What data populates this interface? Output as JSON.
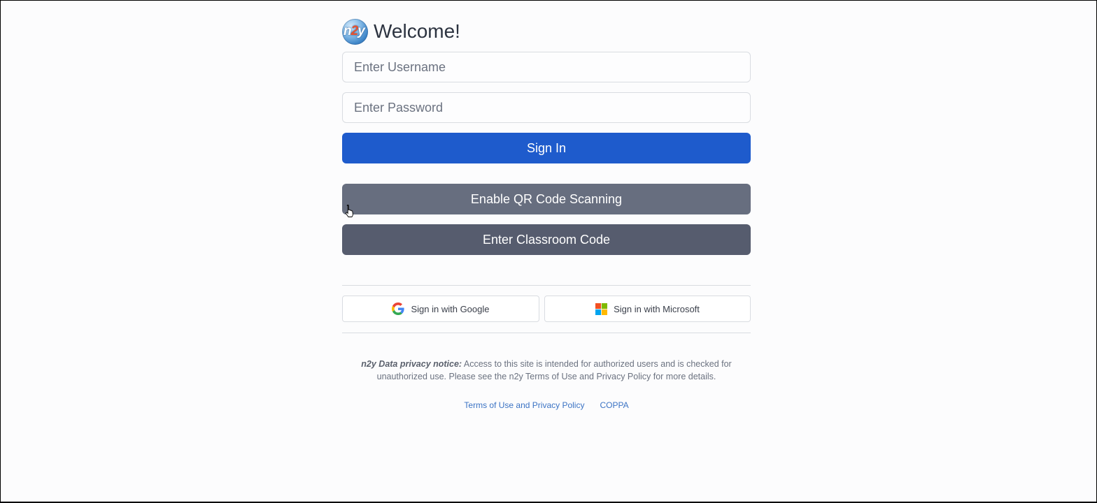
{
  "header": {
    "title": "Welcome!",
    "logo_text_a": "n",
    "logo_text_b": "2",
    "logo_text_c": "y"
  },
  "form": {
    "username_placeholder": "Enter Username",
    "username_value": "",
    "password_placeholder": "Enter Password",
    "password_value": "",
    "sign_in_label": "Sign In",
    "qr_label": "Enable QR Code Scanning",
    "classroom_label": "Enter Classroom Code"
  },
  "sso": {
    "google_label": "Sign in with Google",
    "google_icon": "google-icon",
    "microsoft_label": "Sign in with Microsoft",
    "microsoft_icon": "microsoft-icon"
  },
  "privacy": {
    "heading": "n2y Data privacy notice:",
    "text": " Access to this site is intended for authorized users and is checked for unauthorized use. Please see the n2y Terms of Use and Privacy Policy for more details."
  },
  "links": {
    "terms": "Terms of Use and Privacy Policy",
    "coppa": "COPPA"
  },
  "colors": {
    "primary": "#1e5bcc",
    "qr_button": "#676e7f",
    "classroom_button": "#565c6e",
    "link": "#3b73c4",
    "background": "#fcfcfd"
  }
}
